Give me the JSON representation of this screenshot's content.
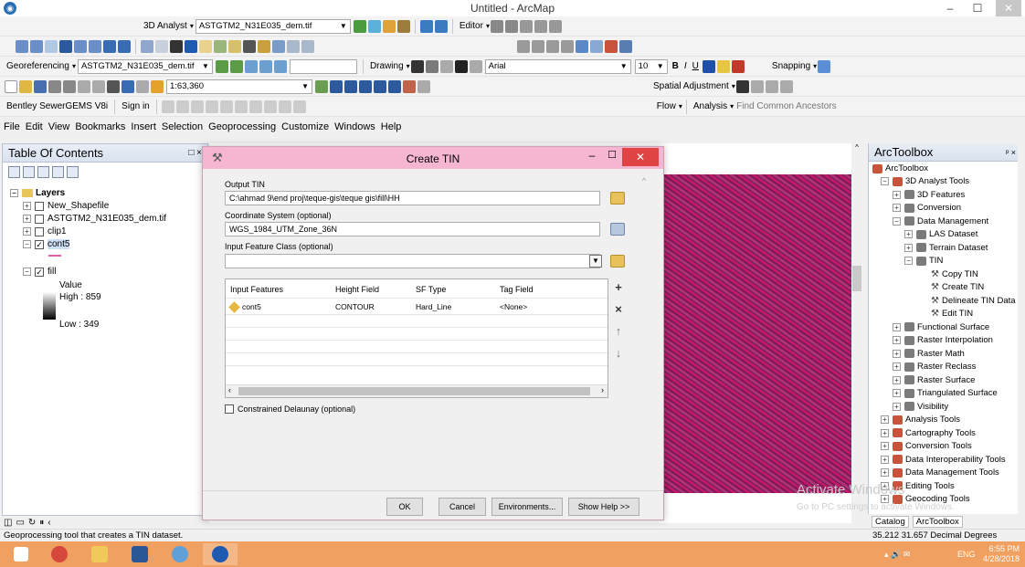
{
  "window": {
    "title": "Untitled - ArcMap",
    "min": "–",
    "max": "☐",
    "close": "✕"
  },
  "toolbars": {
    "row1": {
      "analyst_menu": "3D Analyst",
      "layer_combo": "ASTGTM2_N31E035_dem.tif",
      "editor_menu": "Editor"
    },
    "row3": {
      "georef_menu": "Georeferencing",
      "georef_layer": "ASTGTM2_N31E035_dem.tif",
      "drawing_menu": "Drawing",
      "font": "Arial",
      "font_size": "10",
      "snapping_menu": "Snapping"
    },
    "row4": {
      "scale": "1:63,360",
      "spatial_adjustment_menu": "Spatial Adjustment"
    },
    "row5": {
      "bentley": "Bentley SewerGEMS V8i",
      "sign_in": "Sign in",
      "flow_menu": "Flow",
      "analysis_menu": "Analysis",
      "find_ancestors": "Find Common Ancestors"
    }
  },
  "menu": [
    "File",
    "Edit",
    "View",
    "Bookmarks",
    "Insert",
    "Selection",
    "Geoprocessing",
    "Customize",
    "Windows",
    "Help"
  ],
  "toc": {
    "title": "Table Of Contents",
    "layers_label": "Layers",
    "items": [
      {
        "label": "New_Shapefile",
        "checked": false
      },
      {
        "label": "ASTGTM2_N31E035_dem.tif",
        "checked": false
      },
      {
        "label": "clip1",
        "checked": false
      },
      {
        "label": "cont5",
        "checked": true
      },
      {
        "label": "fill",
        "checked": true
      }
    ],
    "legend": {
      "value_label": "Value",
      "high": "High : 859",
      "low": "Low : 349"
    }
  },
  "dialog": {
    "title": "Create TIN",
    "output_tin_label": "Output TIN",
    "output_tin_value": "C:\\ahmad 9\\end proj\\teque-gis\\teque gis\\fill\\HH",
    "coord_label": "Coordinate System (optional)",
    "coord_value": "WGS_1984_UTM_Zone_36N",
    "input_fc_label": "Input Feature Class (optional)",
    "input_fc_value": "",
    "grid": {
      "headers": [
        "Input Features",
        "Height Field",
        "SF Type",
        "Tag Field"
      ],
      "row": [
        "cont5",
        "CONTOUR",
        "Hard_Line",
        "<None>"
      ]
    },
    "constrained_label": "Constrained Delaunay (optional)",
    "ok": "OK",
    "cancel": "Cancel",
    "environments": "Environments...",
    "show_help": "Show Help >>"
  },
  "arctoolbox": {
    "title": "ArcToolbox",
    "root": "ArcToolbox",
    "items": [
      {
        "label": "3D Analyst Tools",
        "level": 1,
        "kind": "toolbox",
        "expanded": true
      },
      {
        "label": "3D Features",
        "level": 2,
        "kind": "toolset",
        "expanded": false
      },
      {
        "label": "Conversion",
        "level": 2,
        "kind": "toolset",
        "expanded": false
      },
      {
        "label": "Data Management",
        "level": 2,
        "kind": "toolset",
        "expanded": true
      },
      {
        "label": "LAS Dataset",
        "level": 3,
        "kind": "toolset",
        "expanded": false
      },
      {
        "label": "Terrain Dataset",
        "level": 3,
        "kind": "toolset",
        "expanded": false
      },
      {
        "label": "TIN",
        "level": 3,
        "kind": "toolset",
        "expanded": true
      },
      {
        "label": "Copy TIN",
        "level": 4,
        "kind": "tool"
      },
      {
        "label": "Create TIN",
        "level": 4,
        "kind": "tool"
      },
      {
        "label": "Delineate TIN Data",
        "level": 4,
        "kind": "tool"
      },
      {
        "label": "Edit TIN",
        "level": 4,
        "kind": "tool"
      },
      {
        "label": "Functional Surface",
        "level": 2,
        "kind": "toolset",
        "expanded": false
      },
      {
        "label": "Raster Interpolation",
        "level": 2,
        "kind": "toolset",
        "expanded": false
      },
      {
        "label": "Raster Math",
        "level": 2,
        "kind": "toolset",
        "expanded": false
      },
      {
        "label": "Raster Reclass",
        "level": 2,
        "kind": "toolset",
        "expanded": false
      },
      {
        "label": "Raster Surface",
        "level": 2,
        "kind": "toolset",
        "expanded": false
      },
      {
        "label": "Triangulated Surface",
        "level": 2,
        "kind": "toolset",
        "expanded": false
      },
      {
        "label": "Visibility",
        "level": 2,
        "kind": "toolset",
        "expanded": false
      },
      {
        "label": "Analysis Tools",
        "level": 1,
        "kind": "toolbox",
        "expanded": false
      },
      {
        "label": "Cartography Tools",
        "level": 1,
        "kind": "toolbox",
        "expanded": false
      },
      {
        "label": "Conversion Tools",
        "level": 1,
        "kind": "toolbox",
        "expanded": false
      },
      {
        "label": "Data Interoperability Tools",
        "level": 1,
        "kind": "toolbox",
        "expanded": false
      },
      {
        "label": "Data Management Tools",
        "level": 1,
        "kind": "toolbox",
        "expanded": false
      },
      {
        "label": "Editing Tools",
        "level": 1,
        "kind": "toolbox",
        "expanded": false
      },
      {
        "label": "Geocoding Tools",
        "level": 1,
        "kind": "toolbox",
        "expanded": false
      }
    ],
    "tabs": [
      "Catalog",
      "ArcToolbox"
    ]
  },
  "status": {
    "left": "Geoprocessing tool that creates a TIN dataset.",
    "right": "35.212  31.657 Decimal Degrees"
  },
  "watermark": {
    "line1": "Activate Windows",
    "line2": "Go to PC settings to activate Windows."
  },
  "taskbar": {
    "lang": "ENG",
    "time": "6:55 PM",
    "date": "4/28/2018"
  },
  "colors": {
    "dialog_title": "#f6b6d1",
    "taskbar": "#f0a060",
    "raster": "#c2186c",
    "close_btn": "#e04343"
  }
}
